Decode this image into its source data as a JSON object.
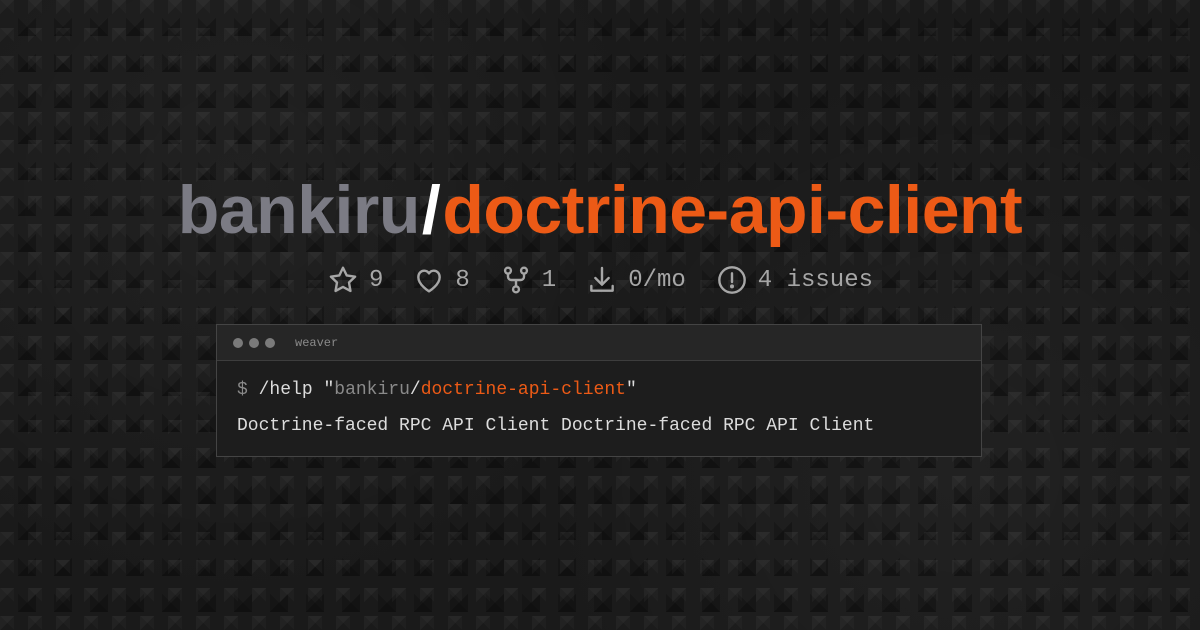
{
  "title": {
    "owner": "bankiru",
    "slash": "/",
    "repo": "doctrine-api-client"
  },
  "stats": [
    {
      "icon": "star-icon",
      "value": "9"
    },
    {
      "icon": "heart-icon",
      "value": "8"
    },
    {
      "icon": "fork-icon",
      "value": "1"
    },
    {
      "icon": "download-icon",
      "value": "0/mo"
    },
    {
      "icon": "alert-circle-icon",
      "value": "4 issues"
    }
  ],
  "terminal": {
    "window_title": "weaver",
    "prompt": "$",
    "command": "/help",
    "quote_open": "\"",
    "arg_owner": "bankiru",
    "arg_slash": "/",
    "arg_repo": "doctrine-api-client",
    "quote_close": "\"",
    "output": "Doctrine-faced RPC API Client Doctrine-faced RPC API Client"
  },
  "colors": {
    "accent": "#ec5a16",
    "owner": "#7b7b84",
    "background": "#1a1a1a"
  }
}
